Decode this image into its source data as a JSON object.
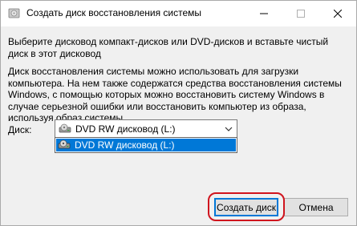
{
  "window": {
    "title": "Создать диск восстановления системы",
    "controls": {
      "minimize": "minimize",
      "maximize": "maximize",
      "close": "close"
    }
  },
  "content": {
    "instruction": "Выберите дисковод компакт-дисков или DVD-дисков и вставьте чистый диск в этот дисковод",
    "description": "Диск восстановления системы можно использовать для загрузки компьютера. На нем также содержатся средства восстановления системы Windows, с помощью которых можно восстановить систему Windows в случае серьезной ошибки или восстановить компьютер из образа, используя образ системы.",
    "disk_label": "Диск:",
    "disk_select": {
      "selected": "DVD RW дисковод (L:)",
      "options": [
        "DVD RW дисковод (L:)"
      ]
    }
  },
  "buttons": {
    "create": "Создать диск",
    "cancel": "Отмена"
  },
  "colors": {
    "selection": "#0078d7",
    "highlight_ring": "#d0141e",
    "title_bar": "#ffffff",
    "window_bg": "#f0f0f0"
  }
}
